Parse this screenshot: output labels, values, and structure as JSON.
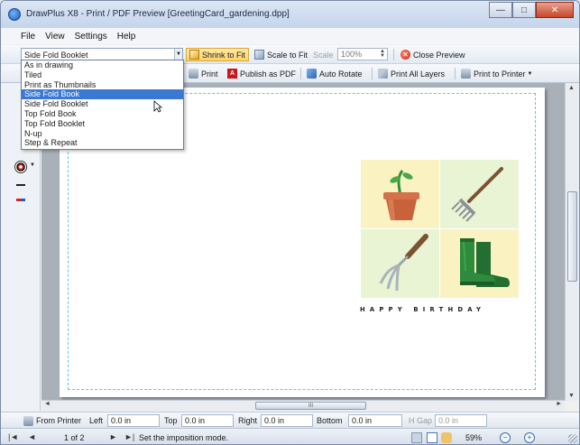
{
  "window": {
    "title": "DrawPlus X8 - Print / PDF Preview [GreetingCard_gardening.dpp]",
    "controls": {
      "minimize": "—",
      "maximize": "□",
      "close": "✕"
    }
  },
  "menu": [
    "File",
    "View",
    "Settings",
    "Help"
  ],
  "toolbar1": {
    "imposition_value": "Side Fold Booklet",
    "shrink_to_fit": "Shrink to Fit",
    "scale_to_fit": "Scale to Fit",
    "scale_label": "Scale",
    "scale_value": "100%",
    "close_preview": "Close Preview"
  },
  "toolbar2": {
    "print": "Print",
    "publish_pdf": "Publish as PDF",
    "auto_rotate": "Auto Rotate",
    "print_all_layers": "Print All Layers",
    "print_to_printer": "Print to Printer"
  },
  "imposition_options": [
    "As in drawing",
    "Tiled",
    "Print as Thumbnails",
    "Side Fold Book",
    "Side Fold Booklet",
    "Top Fold Book",
    "Top Fold Booklet",
    "N-up",
    "Step & Repeat"
  ],
  "imposition_selected_index": 3,
  "card": {
    "greeting": "HAPPY BIRTHDAY",
    "tiles": [
      "flowerpot-with-seedling",
      "garden-rake",
      "hand-fork",
      "green-wellington-boots"
    ]
  },
  "scroll": {
    "h_thumb_text": "III"
  },
  "margins": {
    "from_printer": "From Printer",
    "left_label": "Left",
    "left_value": "0.0 in",
    "top_label": "Top",
    "top_value": "0.0 in",
    "right_label": "Right",
    "right_value": "0.0 in",
    "bottom_label": "Bottom",
    "bottom_value": "0.0 in",
    "hgap_label": "H Gap",
    "hgap_value": "0.0 in"
  },
  "status": {
    "page_text": "1 of 2",
    "hint": "Set the imposition mode.",
    "zoom": "59%"
  },
  "colors": {
    "accent": "#3a78d2",
    "margin_guide": "#5fc6e6",
    "tile_cream": "#fbf2c2",
    "tile_green": "#e9f4d4",
    "boot_green": "#2e8a3c",
    "pot_terracotta": "#c8623a"
  }
}
